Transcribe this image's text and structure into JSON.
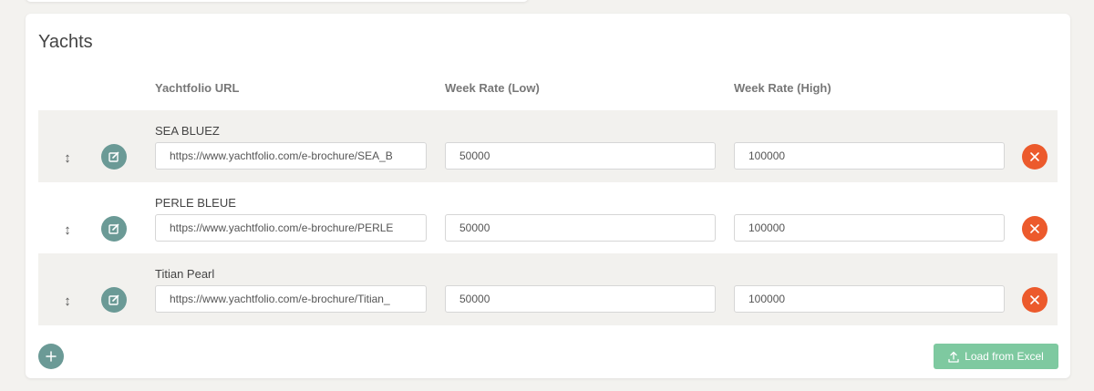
{
  "section": {
    "title": "Yachts"
  },
  "columns": {
    "url": "Yachtfolio URL",
    "week_low": "Week Rate (Low)",
    "week_high": "Week Rate (High)"
  },
  "rows": [
    {
      "name": "SEA BLUEZ",
      "url": "https://www.yachtfolio.com/e-brochure/SEA_B",
      "week_low": "50000",
      "week_high": "100000"
    },
    {
      "name": "PERLE BLEUE",
      "url": "https://www.yachtfolio.com/e-brochure/PERLE",
      "week_low": "50000",
      "week_high": "100000"
    },
    {
      "name": "Titian Pearl",
      "url": "https://www.yachtfolio.com/e-brochure/Titian_",
      "week_low": "50000",
      "week_high": "100000"
    }
  ],
  "footer": {
    "load_excel_label": "Load from Excel"
  },
  "icons": {
    "drag": "drag-handle-icon",
    "edit": "edit-icon",
    "delete": "close-icon",
    "add": "plus-icon",
    "upload": "upload-icon"
  },
  "colors": {
    "teal": "#6b9a96",
    "delete_orange": "#ec5a2c",
    "excel_green": "#7ec9a0",
    "row_shade": "#f2f1ee"
  }
}
